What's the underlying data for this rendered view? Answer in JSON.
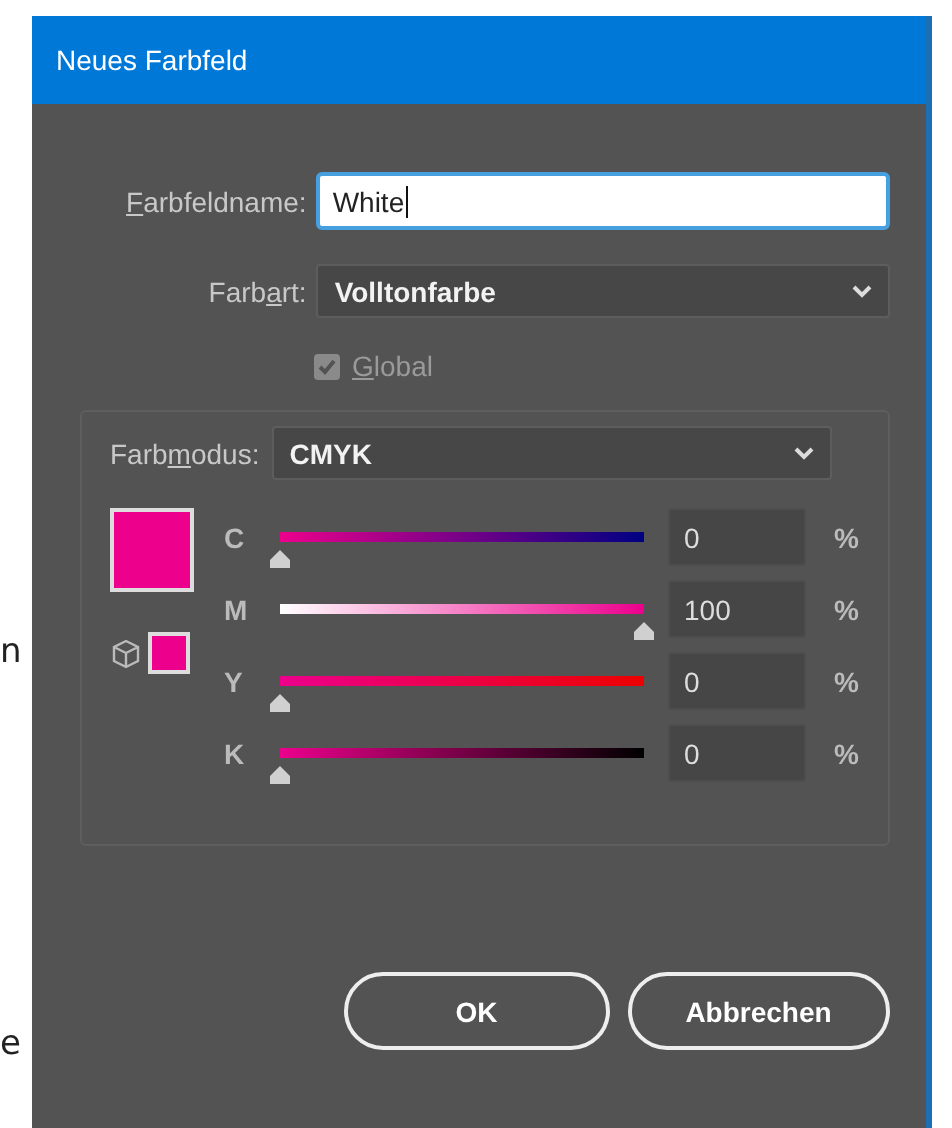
{
  "background_fragments": [
    "n",
    "e"
  ],
  "window": {
    "title": "Neues Farbfeld"
  },
  "name_field": {
    "label_parts": [
      {
        "text": "F",
        "underlined": true
      },
      {
        "text": "arbfeldname:",
        "underlined": false
      }
    ],
    "value": "White",
    "focused": true
  },
  "type_select": {
    "label_parts": [
      {
        "text": "Farb",
        "underlined": false
      },
      {
        "text": "a",
        "underlined": true
      },
      {
        "text": "rt:",
        "underlined": false
      }
    ],
    "value": "Volltonfarbe"
  },
  "global_checkbox": {
    "label_parts": [
      {
        "text": "G",
        "underlined": true
      },
      {
        "text": "lobal",
        "underlined": false
      }
    ],
    "checked": true,
    "disabled": true
  },
  "mode_select": {
    "label_parts": [
      {
        "text": "Farb",
        "underlined": false
      },
      {
        "text": "m",
        "underlined": true
      },
      {
        "text": "odus:",
        "underlined": false
      }
    ],
    "value": "CMYK"
  },
  "channels": [
    {
      "name": "C",
      "level": 0,
      "value": "0",
      "unit": "%"
    },
    {
      "name": "M",
      "level": 1,
      "value": "100",
      "unit": "%"
    },
    {
      "name": "Y",
      "level": 0,
      "value": "0",
      "unit": "%"
    },
    {
      "name": "K",
      "level": 0,
      "value": "0",
      "unit": "%"
    }
  ],
  "buttons": [
    {
      "label": "OK"
    },
    {
      "label": "Abbrechen"
    }
  ]
}
